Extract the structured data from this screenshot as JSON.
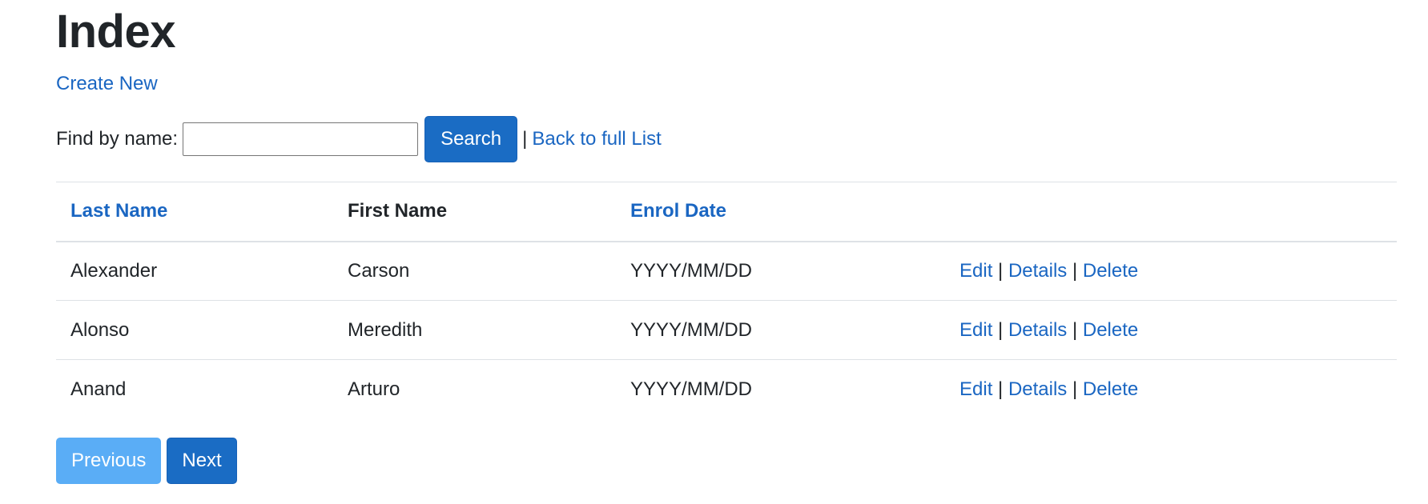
{
  "page": {
    "title": "Index",
    "create_new": "Create New"
  },
  "search": {
    "label": "Find by name:",
    "value": "",
    "placeholder": "",
    "button": "Search",
    "separator": "|",
    "back_link": "Back to full List"
  },
  "table": {
    "headers": {
      "last_name": "Last Name",
      "first_name": "First Name",
      "enrol_date": "Enrol Date"
    },
    "rows": [
      {
        "last_name": "Alexander",
        "first_name": "Carson",
        "enrol_date": "YYYY/MM/DD"
      },
      {
        "last_name": "Alonso",
        "first_name": "Meredith",
        "enrol_date": "YYYY/MM/DD"
      },
      {
        "last_name": "Anand",
        "first_name": "Arturo",
        "enrol_date": "YYYY/MM/DD"
      }
    ],
    "actions": {
      "edit": "Edit",
      "details": "Details",
      "delete": "Delete",
      "separator": "|"
    }
  },
  "pager": {
    "previous": "Previous",
    "next": "Next",
    "previous_disabled": true
  },
  "colors": {
    "link": "#1a66c2",
    "primary_button": "#1a6cc4",
    "disabled_button": "#5aadf6",
    "text": "#212529"
  }
}
